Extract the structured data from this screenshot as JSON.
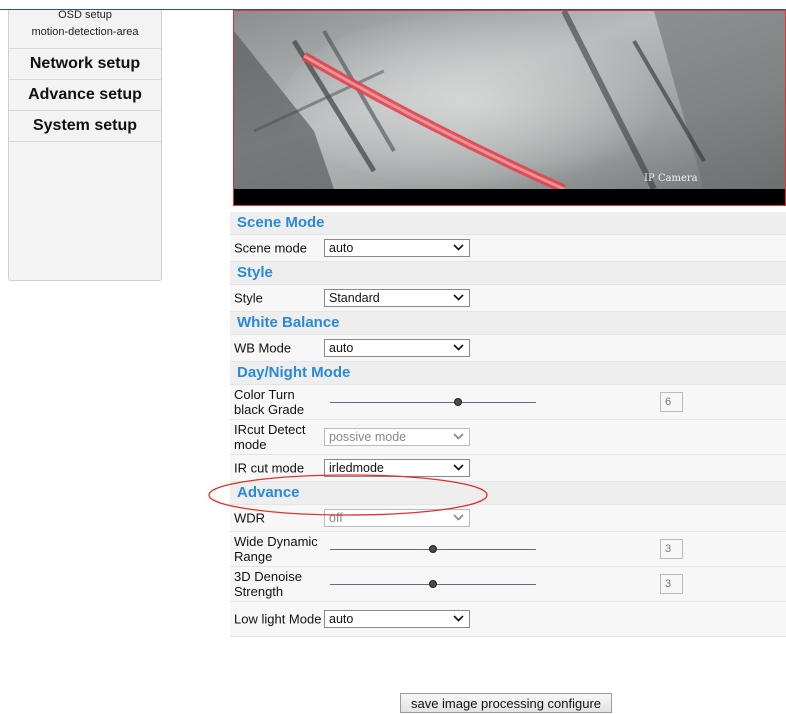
{
  "sidebar": {
    "sub_items": [
      {
        "label": "OSD setup"
      },
      {
        "label": "motion-detection-area"
      }
    ],
    "main_items": [
      {
        "label": "Network setup"
      },
      {
        "label": "Advance setup"
      },
      {
        "label": "System setup"
      }
    ]
  },
  "video": {
    "overlay_text": "IP Camera"
  },
  "sections": {
    "scene": {
      "title": "Scene Mode",
      "rows": [
        {
          "label": "Scene mode",
          "value": "auto"
        }
      ]
    },
    "style": {
      "title": "Style",
      "rows": [
        {
          "label": "Style",
          "value": "Standard"
        }
      ]
    },
    "wb": {
      "title": "White Balance",
      "rows": [
        {
          "label": "WB Mode",
          "value": "auto"
        }
      ]
    },
    "daynight": {
      "title": "Day/Night Mode",
      "color_turn": {
        "label": "Color Turn black Grade",
        "value": "6",
        "slider_fraction": 0.62
      },
      "ircut_detect": {
        "label": "IRcut Detect mode",
        "value": "possive mode"
      },
      "ircut_mode": {
        "label": "IR cut mode",
        "value": "irledmode"
      }
    },
    "advance": {
      "title": "Advance",
      "wdr": {
        "label": "WDR",
        "value": "off"
      },
      "wide_dynamic": {
        "label": "Wide Dynamic Range",
        "value": "3",
        "slider_fraction": 0.5
      },
      "denoise": {
        "label": "3D Denoise Strength",
        "value": "3",
        "slider_fraction": 0.5
      },
      "low_light": {
        "label": "Low light Mode",
        "value": "auto"
      }
    }
  },
  "save_button": {
    "label": "save image processing configure"
  },
  "icons": {
    "select_arrow": "chevron-down-icon",
    "slider_knob": "slider-knob-icon"
  },
  "colors": {
    "section_title": "#2a8ad6",
    "highlight": "#d9332e",
    "top_border": "#1b5aa3"
  }
}
